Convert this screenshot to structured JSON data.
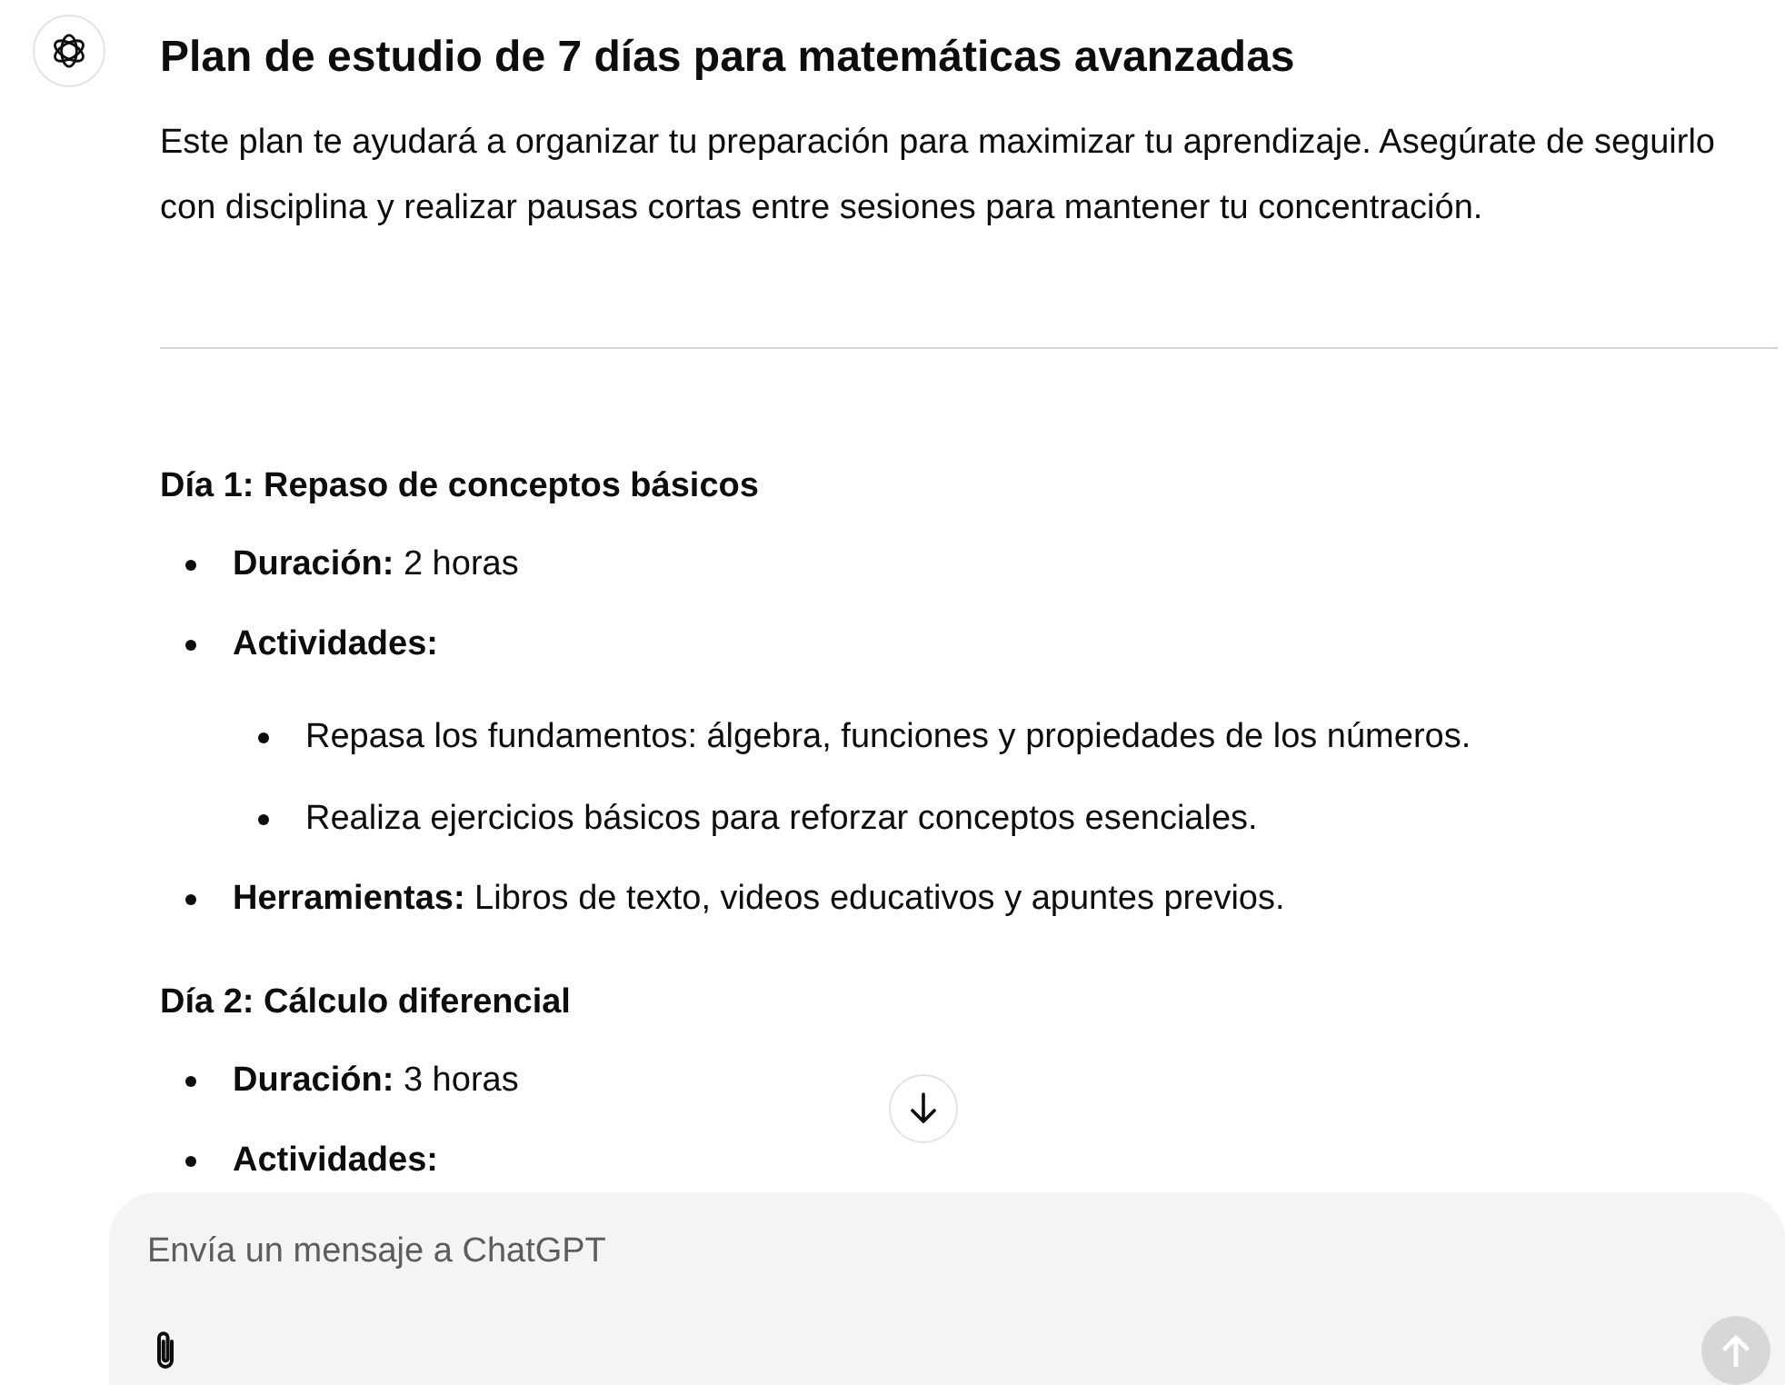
{
  "message": {
    "title": "Plan de estudio de 7 días para matemáticas avanzadas",
    "intro": "Este plan te ayudará a organizar tu preparación para maximizar tu aprendizaje. Asegúrate de seguirlo con disciplina y realizar pausas cortas entre sesiones para mantener tu concentración.",
    "sections": [
      {
        "heading": "Día 1: Repaso de conceptos básicos",
        "items": [
          {
            "label": "Duración:",
            "value": "2 horas"
          },
          {
            "label": "Actividades:",
            "children": [
              "Repasa los fundamentos: álgebra, funciones y propiedades de los números.",
              "Realiza ejercicios básicos para reforzar conceptos esenciales."
            ]
          },
          {
            "label": "Herramientas:",
            "value": "Libros de texto, videos educativos y apuntes previos."
          }
        ]
      },
      {
        "heading": "Día 2: Cálculo diferencial",
        "items": [
          {
            "label": "Duración:",
            "value": "3 horas"
          },
          {
            "label": "Actividades:"
          }
        ]
      }
    ]
  },
  "composer": {
    "placeholder": "Envía un mensaje a ChatGPT",
    "send_button": {
      "disabled": true
    }
  }
}
